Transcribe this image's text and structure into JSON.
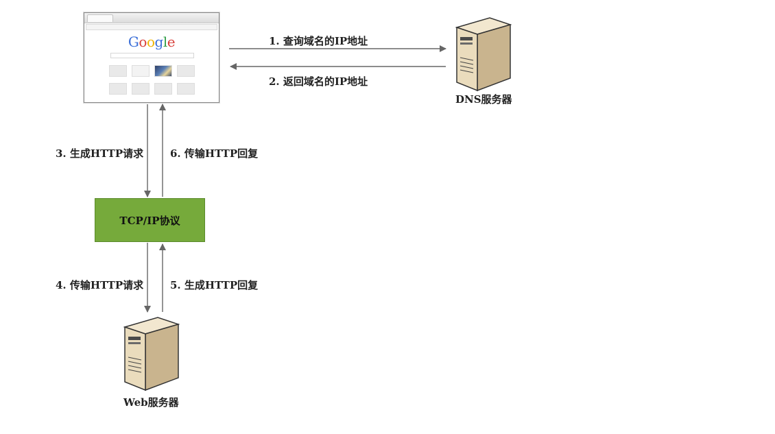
{
  "browser": {
    "logo_text": "Google",
    "logo_colors": [
      "#3b6fd8",
      "#d8403a",
      "#f0b400",
      "#3b6fd8",
      "#2e9d45",
      "#d8403a"
    ]
  },
  "dns_server": {
    "label": "DNS服务器"
  },
  "web_server": {
    "label": "Web服务器"
  },
  "tcp_box": {
    "label": "TCP/IP协议",
    "fill": "#76aa3b"
  },
  "steps": {
    "step1": "1. 查询域名的IP地址",
    "step2": "2. 返回域名的IP地址",
    "step3": "3. 生成HTTP请求",
    "step4": "4. 传输HTTP请求",
    "step5": "5. 生成HTTP回复",
    "step6": "6. 传输HTTP回复"
  },
  "colors": {
    "arrow": "#666666",
    "server_body": "#e9dcc0",
    "server_shadow": "#b9a27e"
  }
}
